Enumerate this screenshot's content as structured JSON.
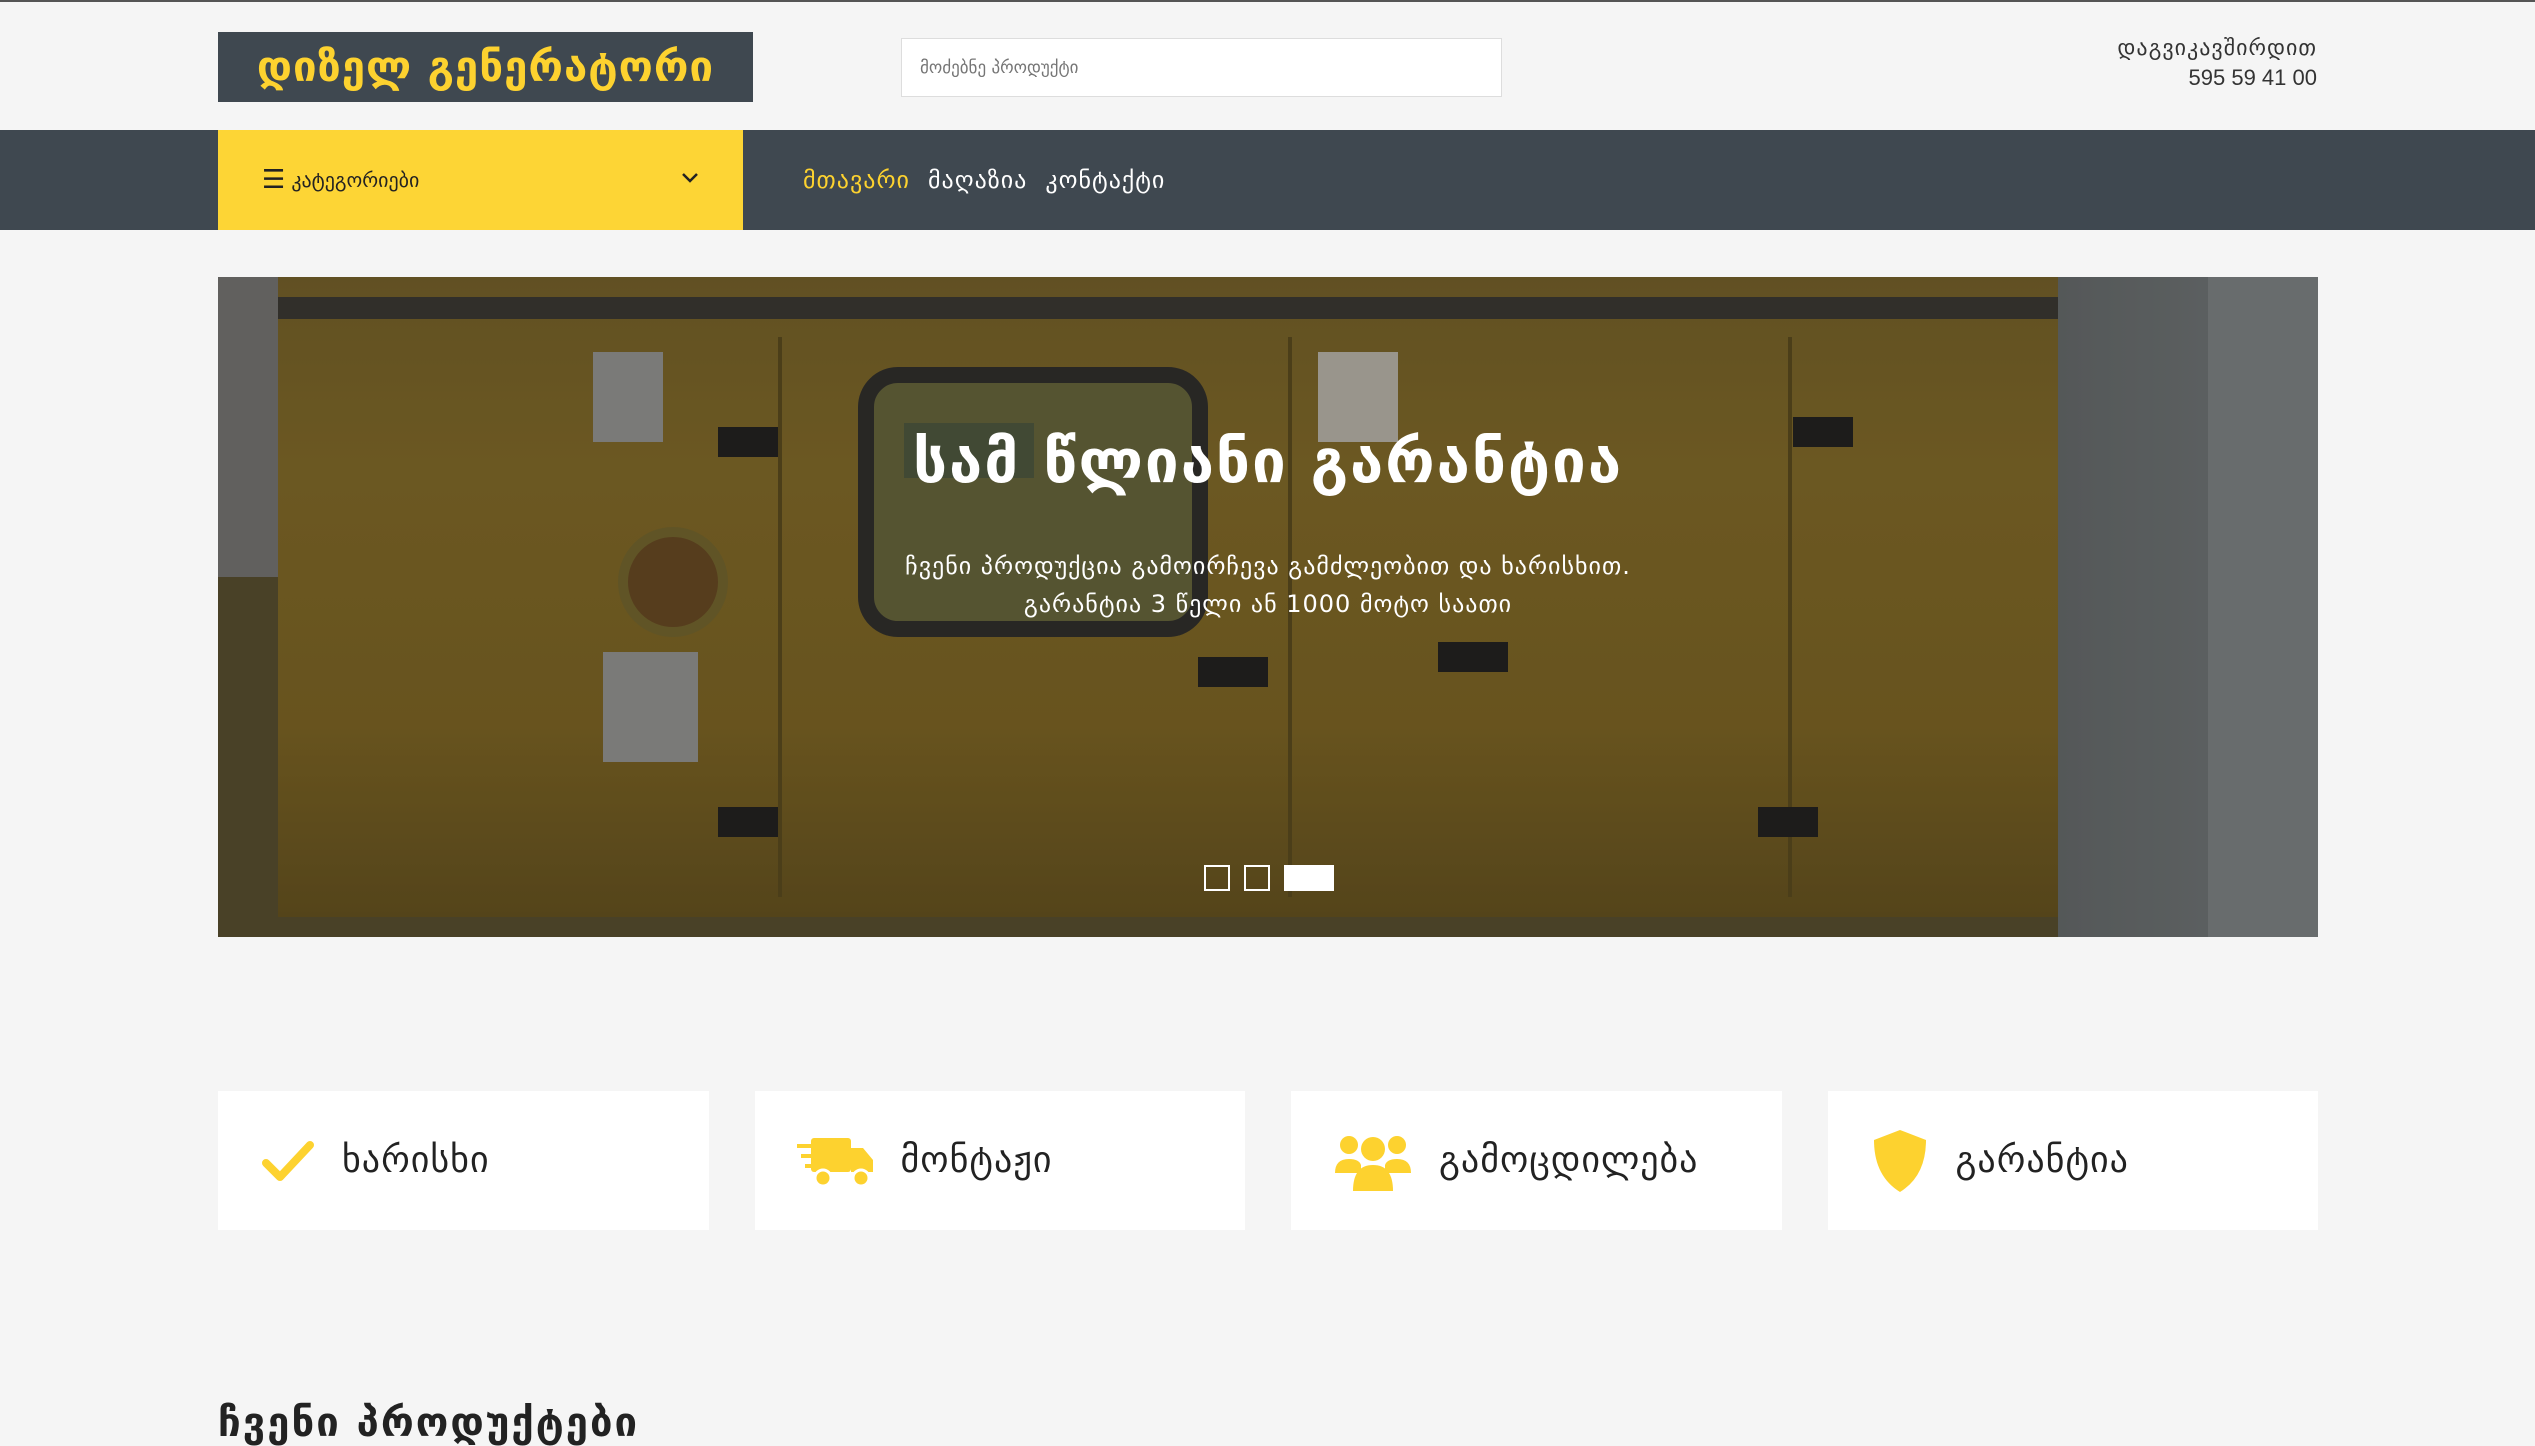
{
  "header": {
    "logo_text": "დიზელ გენერატორი",
    "search_placeholder": "მოძებნე პროდუქტი",
    "contact_label": "დაგვიკავშირდით",
    "contact_phone": "595 59 41 00"
  },
  "nav": {
    "categories_label": "კატეგორიები",
    "links": [
      {
        "label": "მთავარი",
        "active": true
      },
      {
        "label": "მაღაზია",
        "active": false
      },
      {
        "label": "კონტაქტი",
        "active": false
      }
    ]
  },
  "hero": {
    "title": "სამ წლიანი გარანტია",
    "subtitle_line1": "ჩვენი პროდუქცია გამოირჩევა გამძლეობით და ხარისხით.",
    "subtitle_line2": "გარანტია 3 წელი ან 1000 მოტო საათი",
    "slides_count": 3,
    "active_slide": 3
  },
  "features": [
    {
      "label": "ხარისხი",
      "icon": "checkmark-icon"
    },
    {
      "label": "მონტაჟი",
      "icon": "delivery-truck-icon"
    },
    {
      "label": "გამოცდილება",
      "icon": "users-group-icon"
    },
    {
      "label": "გარანტია",
      "icon": "shield-icon"
    }
  ],
  "colors": {
    "accent": "#fdd535",
    "dark": "#3f4850",
    "background": "#f5f5f5"
  },
  "section": {
    "title_partial": "ჩვენი პროდუქტები"
  }
}
